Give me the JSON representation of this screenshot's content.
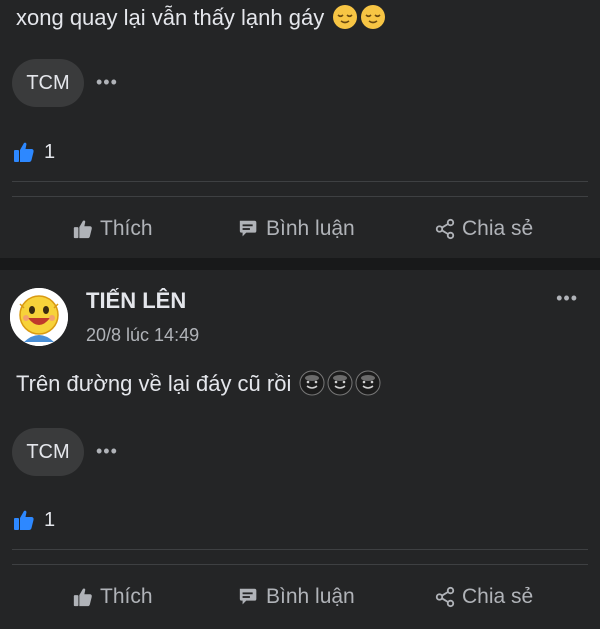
{
  "post_1": {
    "text": "xong quay lại vẫn thấy lạnh gáy",
    "emojis": [
      "relieved-face",
      "relieved-face"
    ],
    "tag": "TCM",
    "tag_more": "•••",
    "like_count": "1"
  },
  "actions": {
    "like": "Thích",
    "comment": "Bình luận",
    "share": "Chia sẻ"
  },
  "post_2": {
    "author": "TIẾN LÊN",
    "timestamp": "20/8 lúc 14:49",
    "menu": "•••",
    "text": "Trên đường về lại đáy cũ rồi",
    "emojis": [
      "smiling-face",
      "smiling-face",
      "smiling-face"
    ],
    "tag": "TCM",
    "tag_more": "•••",
    "like_count": "1"
  },
  "colors": {
    "background": "#242526",
    "separator": "#18191a",
    "chip": "#3a3b3c",
    "muted_text": "#b0b3b8",
    "like_blue": "#2d88ff"
  }
}
